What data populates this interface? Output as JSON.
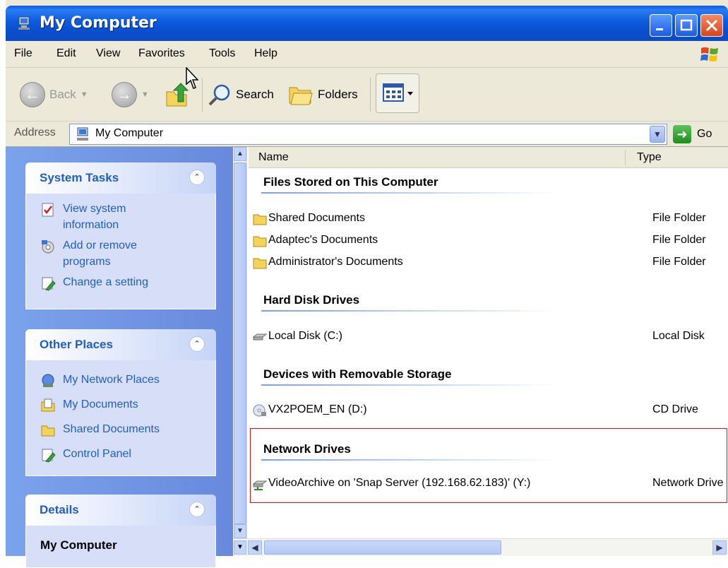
{
  "window": {
    "title": "My Computer"
  },
  "menu": [
    "File",
    "Edit",
    "View",
    "Favorites",
    "Tools",
    "Help"
  ],
  "toolbar": {
    "back_label": "Back",
    "search_label": "Search",
    "folders_label": "Folders"
  },
  "address": {
    "label": "Address",
    "value": "My Computer",
    "go_label": "Go"
  },
  "sidebar": {
    "system_tasks": {
      "title": "System Tasks",
      "items": [
        {
          "label": "View system information",
          "icon": "system-info-icon"
        },
        {
          "label": "Add or remove programs",
          "icon": "add-remove-programs-icon"
        },
        {
          "label": "Change a setting",
          "icon": "control-panel-icon"
        }
      ]
    },
    "other_places": {
      "title": "Other Places",
      "items": [
        {
          "label": "My Network Places",
          "icon": "network-places-icon"
        },
        {
          "label": "My Documents",
          "icon": "my-documents-icon"
        },
        {
          "label": "Shared Documents",
          "icon": "folder-icon"
        },
        {
          "label": "Control Panel",
          "icon": "control-panel-icon"
        }
      ]
    },
    "details": {
      "title": "Details",
      "item_title": "My Computer"
    }
  },
  "list": {
    "columns": {
      "name": "Name",
      "type": "Type"
    },
    "groups": [
      {
        "title": "Files Stored on This Computer",
        "items": [
          {
            "name": "Shared Documents",
            "type": "File Folder",
            "icon": "folder-icon"
          },
          {
            "name": "Adaptec's Documents",
            "type": "File Folder",
            "icon": "folder-icon"
          },
          {
            "name": "Administrator's Documents",
            "type": "File Folder",
            "icon": "folder-icon"
          }
        ]
      },
      {
        "title": "Hard Disk Drives",
        "items": [
          {
            "name": "Local Disk (C:)",
            "type": "Local Disk",
            "icon": "hard-disk-icon"
          }
        ]
      },
      {
        "title": "Devices with Removable Storage",
        "items": [
          {
            "name": "VX2POEM_EN (D:)",
            "type": "CD Drive",
            "icon": "cd-drive-icon"
          }
        ]
      },
      {
        "title": "Network Drives",
        "items": [
          {
            "name": "VideoArchive on 'Snap Server (192.168.62.183)' (Y:)",
            "type": "Network Drive",
            "icon": "network-drive-icon"
          }
        ]
      }
    ]
  },
  "colors": {
    "title_bar": "#0b4bc4",
    "task_pane": "#7ba3ec",
    "link": "#215dc6",
    "highlight_box": "#e01010"
  }
}
